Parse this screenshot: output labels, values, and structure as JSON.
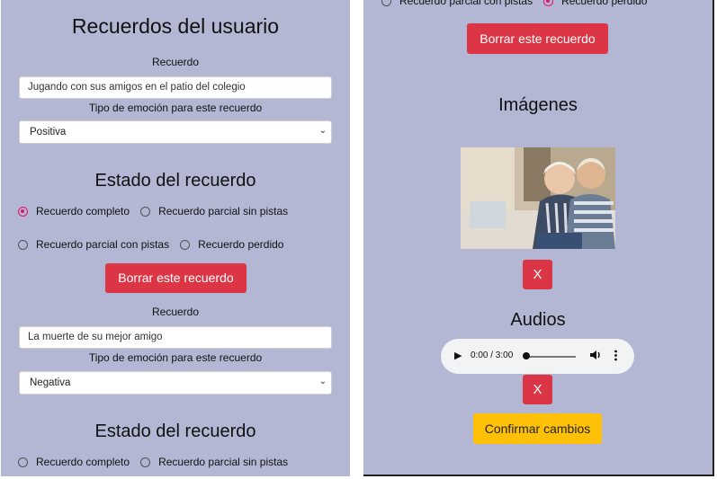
{
  "left": {
    "title": "Recuerdos del usuario",
    "memories": [
      {
        "recuerdo_label": "Recuerdo",
        "recuerdo_value": "Jugando con sus amigos en el patio del colegio",
        "emotion_label": "Tipo de emoción para este recuerdo",
        "emotion_value": "Positiva",
        "state_title": "Estado del recuerdo",
        "radios": [
          "Recuerdo completo",
          "Recuerdo parcial sin pistas",
          "Recuerdo parcial con pistas",
          "Recuerdo perdido"
        ],
        "selected": "Recuerdo completo",
        "delete_label": "Borrar este recuerdo"
      },
      {
        "recuerdo_label": "Recuerdo",
        "recuerdo_value": "La muerte de su mejor amigo",
        "emotion_label": "Tipo de emoción para este recuerdo",
        "emotion_value": "Negativa",
        "state_title": "Estado del recuerdo",
        "radios": [
          "Recuerdo completo",
          "Recuerdo parcial sin pistas"
        ],
        "selected": ""
      }
    ]
  },
  "right": {
    "top_radios": [
      "Recuerdo parcial con pistas",
      "Recuerdo perdido"
    ],
    "top_selected": "Recuerdo perdido",
    "delete_label": "Borrar este recuerdo",
    "images_title": "Imágenes",
    "remove_image_label": "X",
    "audios_title": "Audios",
    "audio_time": "0:00 / 3:00",
    "remove_audio_label": "X",
    "confirm_label": "Confirmar cambios"
  },
  "colors": {
    "panel_bg": "#b3b7d3",
    "danger": "#dc3545",
    "warning": "#ffc107",
    "radio_accent": "#e0156b"
  },
  "icons": [
    "chevron-down-icon",
    "play-icon",
    "volume-icon",
    "more-vert-icon"
  ]
}
